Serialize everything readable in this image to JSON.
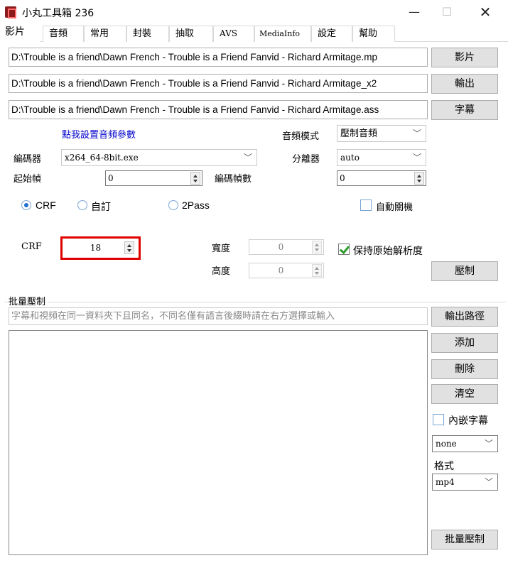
{
  "window": {
    "title": "小丸工具箱 236",
    "minimize": "—",
    "maximize": "☐",
    "close": "✕"
  },
  "tabs": [
    {
      "label": "影片",
      "active": true
    },
    {
      "label": "音頻"
    },
    {
      "label": "常用"
    },
    {
      "label": "封裝"
    },
    {
      "label": "抽取"
    },
    {
      "label": "AVS"
    },
    {
      "label": "MediaInfo"
    },
    {
      "label": "設定"
    },
    {
      "label": "幫助"
    }
  ],
  "files": {
    "video_path": "D:\\Trouble is a friend\\Dawn French - Trouble is a Friend Fanvid - Richard Armitage.mp",
    "video_button": "影片",
    "output_path": "D:\\Trouble is a friend\\Dawn French - Trouble is a Friend Fanvid - Richard Armitage_x2",
    "output_button": "輸出",
    "subtitle_path": "D:\\Trouble is a friend\\Dawn French - Trouble is a Friend Fanvid - Richard Armitage.ass",
    "subtitle_button": "字幕"
  },
  "audio": {
    "settings_link": "點我設置音頻參數",
    "mode_label": "音頻模式",
    "mode_value": "壓制音頻"
  },
  "encoder": {
    "label": "編碼器",
    "value": "x264_64-8bit.exe",
    "splitter_label": "分離器",
    "splitter_value": "auto"
  },
  "frames": {
    "start_label": "起始幀",
    "start_value": "0",
    "count_label": "編碼幀數",
    "count_value": "0"
  },
  "rate_mode": {
    "options": [
      "CRF",
      "自訂",
      "2Pass"
    ],
    "selected": "CRF"
  },
  "auto_shutdown": {
    "label": "自動關機",
    "checked": false
  },
  "crf": {
    "label": "CRF",
    "value": "18"
  },
  "resolution": {
    "width_label": "寬度",
    "width_value": "0",
    "height_label": "高度",
    "height_value": "0",
    "keep_original_label": "保持原始解析度",
    "keep_original_checked": true
  },
  "encode_button": "壓制",
  "batch": {
    "section_title": "批量壓制",
    "hint": "字幕和視頻在同一資料夾下且同名，不同名僅有語言後綴時請在右方選擇或輸入",
    "output_path_button": "輸出路徑",
    "add_button": "添加",
    "delete_button": "刪除",
    "clear_button": "清空",
    "embed_subtitle_label": "內嵌字幕",
    "embed_subtitle_checked": false,
    "subtitle_lang_value": "none",
    "format_label": "格式",
    "format_value": "mp4",
    "batch_encode_button": "批量壓制"
  }
}
